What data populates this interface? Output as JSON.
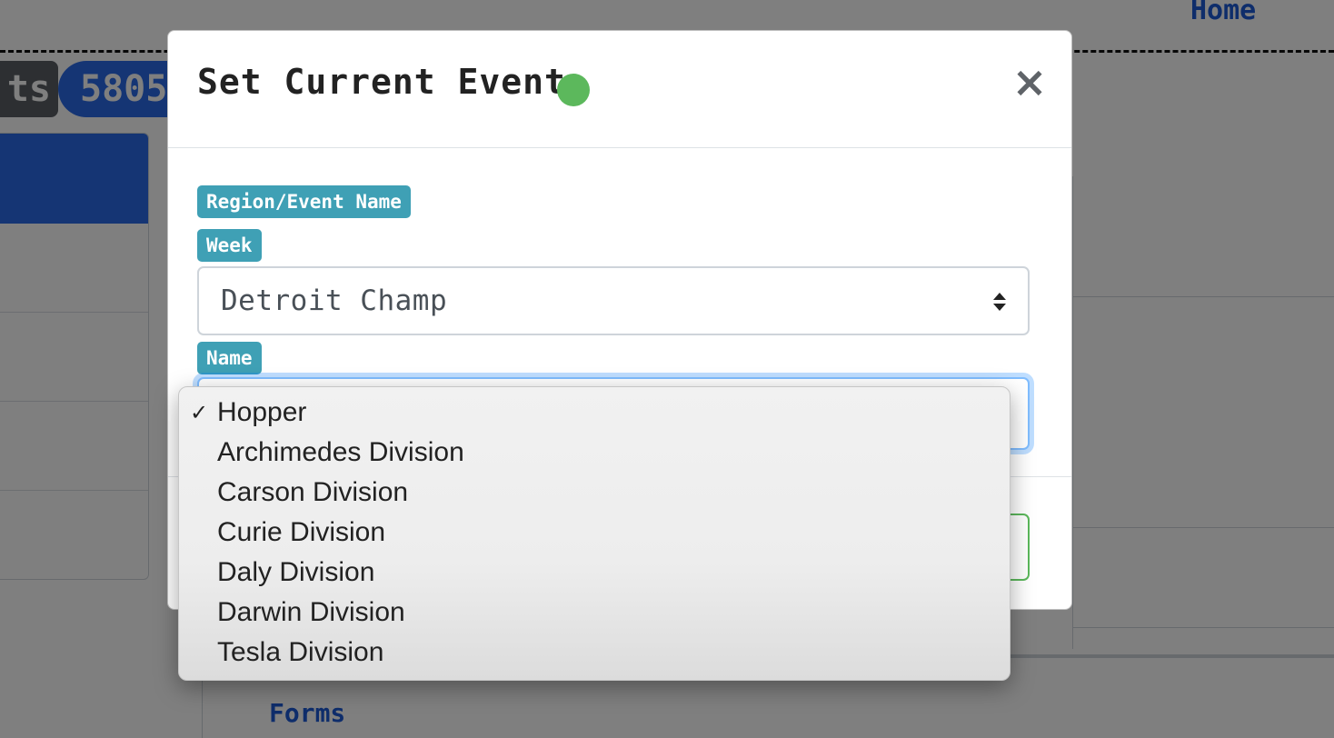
{
  "background": {
    "nav_home": "Home",
    "pill_tab_fragment": "ts",
    "team_number_fragment": "5805",
    "nav_forms": "Forms"
  },
  "modal": {
    "title": "Set Current Event",
    "status_color": "#5cb85c",
    "close_label": "×",
    "labels": {
      "region": "Region/Event Name",
      "week": "Week",
      "name": "Name"
    },
    "event_select": {
      "value": "Detroit Champ",
      "icon": "updown-chevron-icon"
    }
  },
  "dropdown": {
    "selected_index": 0,
    "check_mark": "✓",
    "options": [
      "Hopper",
      "Archimedes Division",
      "Carson Division",
      "Curie Division",
      "Daly Division",
      "Darwin Division",
      "Tesla Division"
    ]
  },
  "colors": {
    "accent_blue": "#2a6ae8",
    "badge_teal": "#3fa0b5",
    "success_green": "#5cb85c",
    "focus_blue": "#80bdff"
  }
}
